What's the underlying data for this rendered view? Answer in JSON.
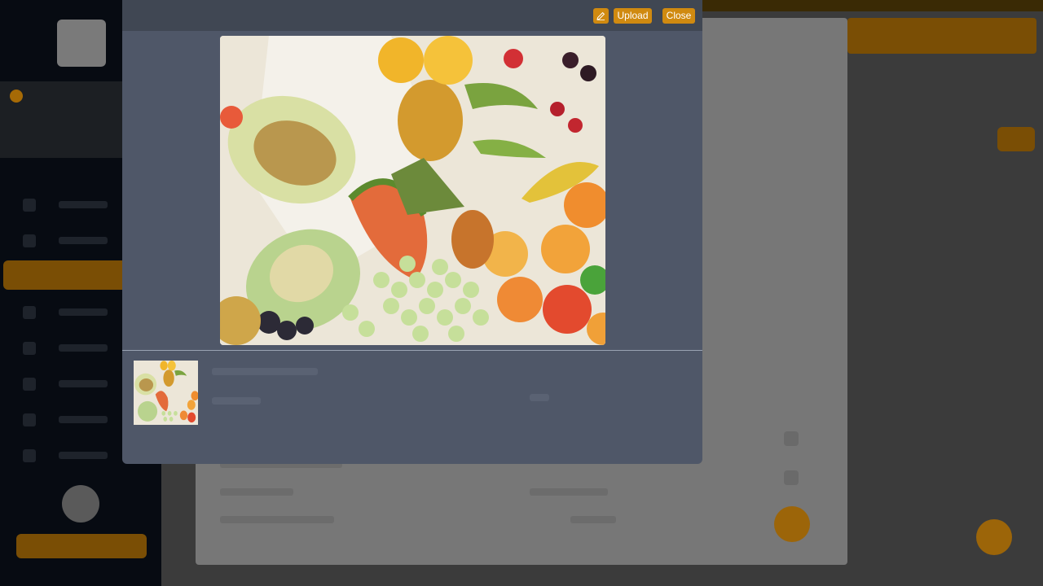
{
  "modal": {
    "upload_label": "Upload",
    "close_label": "Close",
    "edit_icon": "pencil-icon"
  },
  "colors": {
    "accent": "#d08a10",
    "modal_bg": "#4f5768",
    "modal_header": "#404753"
  }
}
